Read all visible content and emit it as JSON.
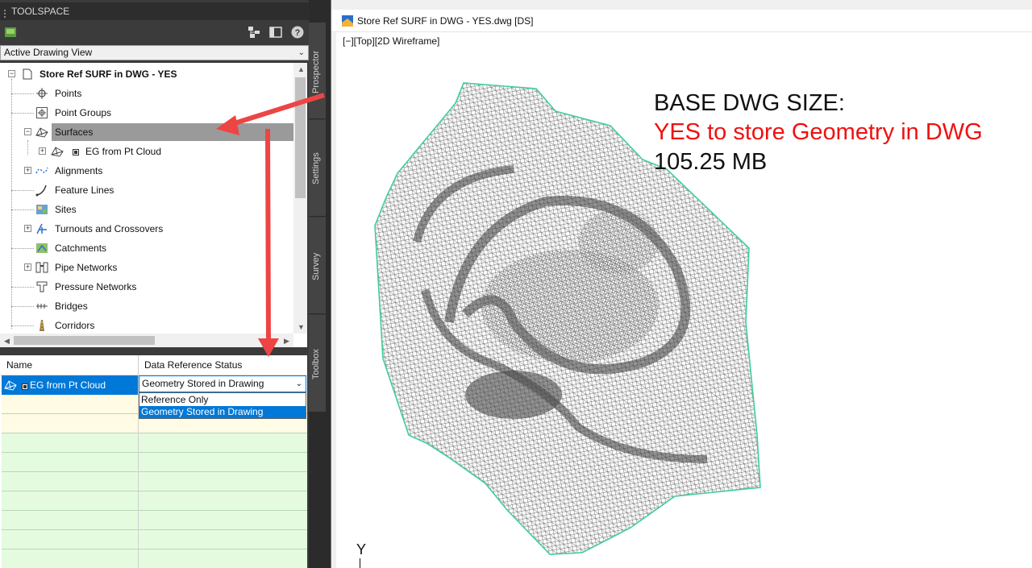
{
  "toolspace": {
    "title": "TOOLSPACE",
    "view_dropdown": "Active Drawing View",
    "tree": {
      "root": "Store Ref SURF in DWG - YES",
      "items": [
        {
          "label": "Points"
        },
        {
          "label": "Point Groups"
        },
        {
          "label": "Surfaces"
        },
        {
          "label": "EG from Pt Cloud"
        },
        {
          "label": "Alignments"
        },
        {
          "label": "Feature Lines"
        },
        {
          "label": "Sites"
        },
        {
          "label": "Turnouts and Crossovers"
        },
        {
          "label": "Catchments"
        },
        {
          "label": "Pipe Networks"
        },
        {
          "label": "Pressure Networks"
        },
        {
          "label": "Bridges"
        },
        {
          "label": "Corridors"
        }
      ]
    },
    "tabs": [
      "Prospector",
      "Settings",
      "Survey",
      "Toolbox"
    ],
    "grid": {
      "columns": [
        "Name",
        "Data Reference Status"
      ],
      "row_name": "EG from Pt Cloud",
      "status_value": "Geometry Stored in Drawing",
      "status_options": [
        "Reference Only",
        "Geometry Stored in Drawing"
      ]
    }
  },
  "drawing": {
    "title": "Store Ref SURF in DWG - YES.dwg [DS]",
    "viewport_label": "[−][Top][2D Wireframe]",
    "notes": {
      "line1": "BASE DWG SIZE:",
      "line2": "YES to store Geometry  in DWG",
      "line3": "105.25 MB"
    },
    "axis_label": "Y"
  },
  "colors": {
    "selection": "#0078d7",
    "annotation_arrow": "#ee4444",
    "note_red": "#ee1111",
    "surface_boundary": "#3ecf96",
    "grid_row_green": "#e4fbe0",
    "grid_row_yellow": "#fffbe4"
  }
}
